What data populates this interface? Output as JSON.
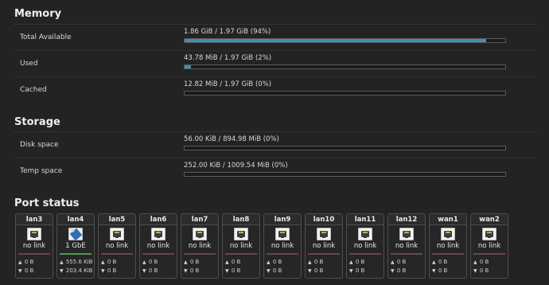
{
  "memory": {
    "title": "Memory",
    "rows": [
      {
        "label": "Total Available",
        "value": "1.86 GiB / 1.97 GiB (94%)",
        "percent": 94
      },
      {
        "label": "Used",
        "value": "43.78 MiB / 1.97 GiB (2%)",
        "percent": 2
      },
      {
        "label": "Cached",
        "value": "12.82 MiB / 1.97 GiB (0%)",
        "percent": 0
      }
    ]
  },
  "storage": {
    "title": "Storage",
    "rows": [
      {
        "label": "Disk space",
        "value": "56.00 KiB / 894.98 MiB (0%)",
        "percent": 0
      },
      {
        "label": "Temp space",
        "value": "252.00 KiB / 1009.54 MiB (0%)",
        "percent": 0
      }
    ]
  },
  "port_status": {
    "title": "Port status",
    "ports": [
      {
        "name": "lan3",
        "status": "no link",
        "tx": "0 B",
        "rx": "0 B",
        "connected": false
      },
      {
        "name": "lan4",
        "status": "1 GbE",
        "tx": "555.6 KiB",
        "rx": "203.4 KiB",
        "connected": true
      },
      {
        "name": "lan5",
        "status": "no link",
        "tx": "0 B",
        "rx": "0 B",
        "connected": false
      },
      {
        "name": "lan6",
        "status": "no link",
        "tx": "0 B",
        "rx": "0 B",
        "connected": false
      },
      {
        "name": "lan7",
        "status": "no link",
        "tx": "0 B",
        "rx": "0 B",
        "connected": false
      },
      {
        "name": "lan8",
        "status": "no link",
        "tx": "0 B",
        "rx": "0 B",
        "connected": false
      },
      {
        "name": "lan9",
        "status": "no link",
        "tx": "0 B",
        "rx": "0 B",
        "connected": false
      },
      {
        "name": "lan10",
        "status": "no link",
        "tx": "0 B",
        "rx": "0 B",
        "connected": false
      },
      {
        "name": "lan11",
        "status": "no link",
        "tx": "0 B",
        "rx": "0 B",
        "connected": false
      },
      {
        "name": "lan12",
        "status": "no link",
        "tx": "0 B",
        "rx": "0 B",
        "connected": false
      },
      {
        "name": "wan1",
        "status": "no link",
        "tx": "0 B",
        "rx": "0 B",
        "connected": false
      },
      {
        "name": "wan2",
        "status": "no link",
        "tx": "0 B",
        "rx": "0 B",
        "connected": false
      }
    ]
  },
  "icons": {
    "tx": "up-arrow-icon",
    "rx": "down-arrow-icon",
    "port": "ethernet-port-icon"
  },
  "colors": {
    "background": "#232323",
    "bar_fill": "#3f8eb3",
    "link_up": "#4e9a4e",
    "link_down": "#6b4545"
  }
}
